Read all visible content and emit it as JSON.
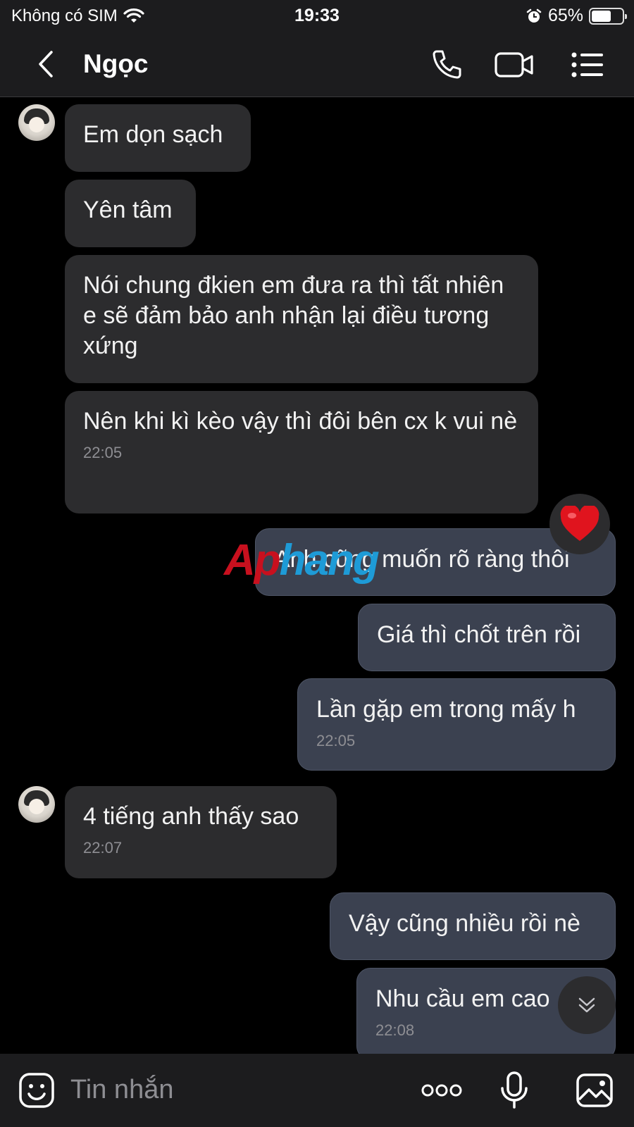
{
  "status_bar": {
    "carrier": "Không có SIM",
    "time": "19:33",
    "battery_percent": "65%",
    "battery_level": 0.65,
    "icons": [
      "wifi-icon",
      "alarm-icon",
      "battery-icon"
    ]
  },
  "header": {
    "contact_name": "Ngọc",
    "icons": [
      "chevron-left-icon",
      "phone-icon",
      "video-camera-icon",
      "list-menu-icon"
    ]
  },
  "messages": [
    {
      "direction": "incoming",
      "text": "Em dọn sạch",
      "time": ""
    },
    {
      "direction": "incoming",
      "text": "Yên tâm",
      "time": ""
    },
    {
      "direction": "incoming",
      "text": "Nói chung đkien em đưa ra thì tất nhiên e sẽ đảm bảo anh nhận lại điều tương xứng",
      "time": ""
    },
    {
      "direction": "incoming",
      "text": "Nên khi kì kèo vậy thì đôi bên cx k vui nè",
      "time": "22:05"
    },
    {
      "direction": "outgoing",
      "text": "Anh cũng muốn rõ ràng thôi",
      "time": "",
      "reaction": "heart"
    },
    {
      "direction": "outgoing",
      "text": "Giá thì chốt trên rồi",
      "time": ""
    },
    {
      "direction": "outgoing",
      "text": "Lần gặp em trong mấy h",
      "time": "22:05"
    },
    {
      "direction": "incoming",
      "text": "4 tiếng anh thấy sao",
      "time": "22:07"
    },
    {
      "direction": "outgoing",
      "text": "Vậy cũng nhiều rồi nè",
      "time": ""
    },
    {
      "direction": "outgoing",
      "text": "Nhu cầu em cao",
      "time": "22:08"
    }
  ],
  "watermark": {
    "part1": "Ap",
    "part2": "hang"
  },
  "input_bar": {
    "placeholder": "Tin nhắn",
    "icons": [
      "sticker-icon",
      "more-icon",
      "microphone-icon",
      "image-icon"
    ]
  },
  "colors": {
    "background": "#000000",
    "bar": "#1c1c1e",
    "incoming_bubble": "#2c2c2e",
    "outgoing_bubble": "#3b4150",
    "timestamp": "#8e8e93",
    "reaction_heart": "#e0141e"
  }
}
